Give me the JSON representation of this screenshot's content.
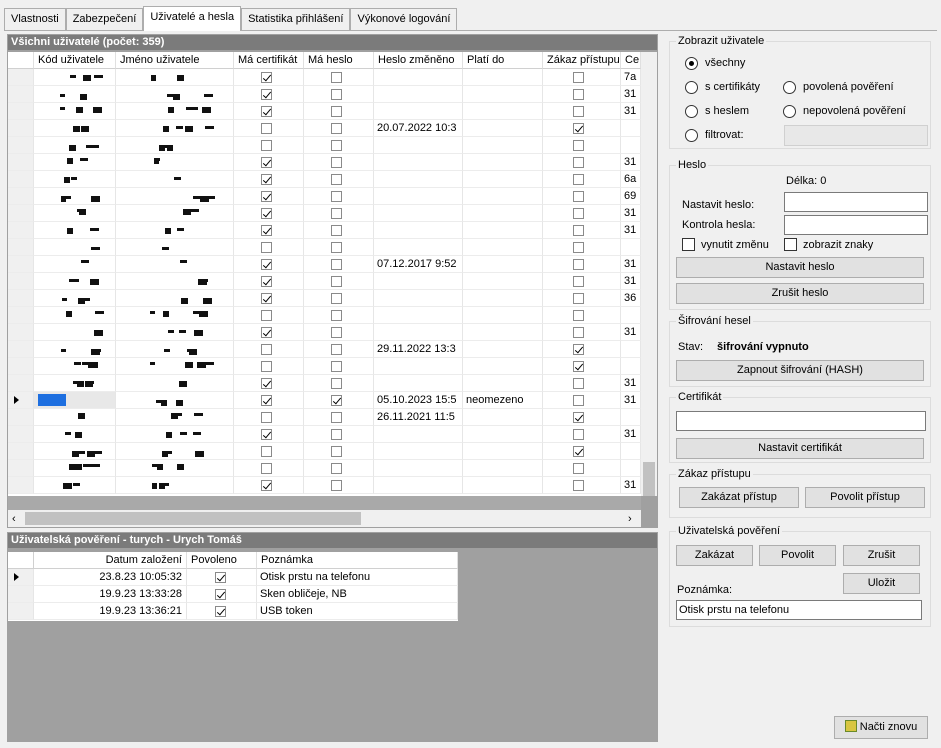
{
  "tabs": [
    {
      "label": "Vlastnosti"
    },
    {
      "label": "Zabezpečení"
    },
    {
      "label": "Uživatelé a hesla"
    },
    {
      "label": "Statistika přihlášení"
    },
    {
      "label": "Výkonové logování"
    }
  ],
  "users_panel": {
    "title": "Všichni uživatelé  (počet: 359)",
    "columns": [
      "Kód uživatele",
      "Jméno uživatele",
      "Má certifikát",
      "Má heslo",
      "Heslo změněno",
      "Platí do",
      "Zákaz přístupu",
      "Ce"
    ],
    "rows": [
      {
        "cert": true,
        "pwd": false,
        "changed": "",
        "valid": "",
        "ban": false,
        "ce": "7a"
      },
      {
        "cert": true,
        "pwd": false,
        "changed": "",
        "valid": "",
        "ban": false,
        "ce": "31"
      },
      {
        "cert": true,
        "pwd": false,
        "changed": "",
        "valid": "",
        "ban": false,
        "ce": "31"
      },
      {
        "cert": false,
        "pwd": false,
        "changed": "20.07.2022 10:3",
        "valid": "",
        "ban": true,
        "ce": ""
      },
      {
        "cert": false,
        "pwd": false,
        "changed": "",
        "valid": "",
        "ban": false,
        "ce": ""
      },
      {
        "cert": true,
        "pwd": false,
        "changed": "",
        "valid": "",
        "ban": false,
        "ce": "31"
      },
      {
        "cert": true,
        "pwd": false,
        "changed": "",
        "valid": "",
        "ban": false,
        "ce": "6a"
      },
      {
        "cert": true,
        "pwd": false,
        "changed": "",
        "valid": "",
        "ban": false,
        "ce": "69"
      },
      {
        "cert": true,
        "pwd": false,
        "changed": "",
        "valid": "",
        "ban": false,
        "ce": "31"
      },
      {
        "cert": true,
        "pwd": false,
        "changed": "",
        "valid": "",
        "ban": false,
        "ce": "31"
      },
      {
        "cert": false,
        "pwd": false,
        "changed": "",
        "valid": "",
        "ban": false,
        "ce": ""
      },
      {
        "cert": true,
        "pwd": false,
        "changed": "07.12.2017 9:52",
        "valid": "",
        "ban": false,
        "ce": "31"
      },
      {
        "cert": true,
        "pwd": false,
        "changed": "",
        "valid": "",
        "ban": false,
        "ce": "31"
      },
      {
        "cert": true,
        "pwd": false,
        "changed": "",
        "valid": "",
        "ban": false,
        "ce": "36"
      },
      {
        "cert": false,
        "pwd": false,
        "changed": "",
        "valid": "",
        "ban": false,
        "ce": ""
      },
      {
        "cert": true,
        "pwd": false,
        "changed": "",
        "valid": "",
        "ban": false,
        "ce": "31"
      },
      {
        "cert": false,
        "pwd": false,
        "changed": "29.11.2022 13:3",
        "valid": "",
        "ban": true,
        "ce": ""
      },
      {
        "cert": false,
        "pwd": false,
        "changed": "",
        "valid": "",
        "ban": true,
        "ce": ""
      },
      {
        "cert": true,
        "pwd": false,
        "changed": "",
        "valid": "",
        "ban": false,
        "ce": "31"
      },
      {
        "cert": true,
        "pwd": true,
        "changed": "05.10.2023 15:5",
        "valid": "neomezeno",
        "ban": false,
        "ce": "31",
        "selected": true
      },
      {
        "cert": false,
        "pwd": false,
        "changed": "26.11.2021 11:5",
        "valid": "",
        "ban": true,
        "ce": ""
      },
      {
        "cert": true,
        "pwd": false,
        "changed": "",
        "valid": "",
        "ban": false,
        "ce": "31"
      },
      {
        "cert": false,
        "pwd": false,
        "changed": "",
        "valid": "",
        "ban": true,
        "ce": ""
      },
      {
        "cert": false,
        "pwd": false,
        "changed": "",
        "valid": "",
        "ban": false,
        "ce": ""
      },
      {
        "cert": true,
        "pwd": false,
        "changed": "",
        "valid": "",
        "ban": false,
        "ce": "31"
      }
    ]
  },
  "rights_panel": {
    "title": "Uživatelská pověření - turych - Urych Tomáš",
    "columns": [
      "Datum založení",
      "Povoleno",
      "Poznámka"
    ],
    "rows": [
      {
        "date": "23.8.23  10:05:32",
        "allowed": true,
        "note": "Otisk prstu na telefonu"
      },
      {
        "date": "19.9.23  13:33:28",
        "allowed": true,
        "note": "Sken obličeje, NB"
      },
      {
        "date": "19.9.23  13:36:21",
        "allowed": true,
        "note": "USB token"
      }
    ]
  },
  "show_users": {
    "title": "Zobrazit uživatele",
    "all": "všechny",
    "with_cert": "s certifikáty",
    "allowed_rights": "povolená pověření",
    "with_pwd": "s heslem",
    "denied_rights": "nepovolená pověření",
    "filter": "filtrovat:"
  },
  "password": {
    "title": "Heslo",
    "length": "Délka: 0",
    "set_label": "Nastavit heslo:",
    "check_label": "Kontrola hesla:",
    "force_change": "vynutit změnu",
    "show_chars": "zobrazit znaky",
    "set_button": "Nastavit heslo",
    "cancel_button": "Zrušit heslo"
  },
  "encryption": {
    "title": "Šifrování hesel",
    "status_label": "Stav:",
    "status_value": "šifrování vypnuto",
    "button": "Zapnout šifrování (HASH)"
  },
  "certificate": {
    "title": "Certifikát",
    "button": "Nastavit certifikát"
  },
  "access": {
    "title": "Zákaz přístupu",
    "deny": "Zakázat přístup",
    "allow": "Povolit přístup"
  },
  "user_rights": {
    "title": "Uživatelská pověření",
    "deny": "Zakázat",
    "allow": "Povolit",
    "cancel": "Zrušit",
    "save": "Uložit",
    "note_label": "Poznámka:",
    "note_value": "Otisk prstu na telefonu"
  },
  "reload": "Načti znovu"
}
